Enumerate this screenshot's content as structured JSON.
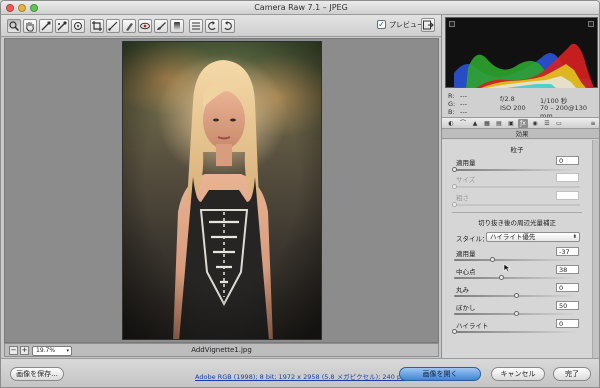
{
  "window": {
    "title": "Camera Raw 7.1  –  JPEG"
  },
  "toolbar": {
    "tools": [
      {
        "name": "zoom-tool-icon",
        "glyph": "🔍"
      },
      {
        "name": "hand-tool-icon",
        "glyph": "✋"
      },
      {
        "name": "white-balance-tool-icon",
        "glyph": "⌖"
      },
      {
        "name": "color-sampler-tool-icon",
        "glyph": "⊕"
      },
      {
        "name": "targeted-adjustment-tool-icon",
        "glyph": "◎"
      },
      {
        "name": "crop-tool-icon",
        "glyph": "⌗"
      },
      {
        "name": "straighten-tool-icon",
        "glyph": "⟋"
      },
      {
        "name": "spot-removal-tool-icon",
        "glyph": "✎"
      },
      {
        "name": "red-eye-tool-icon",
        "glyph": "◉"
      },
      {
        "name": "adjustment-brush-icon",
        "glyph": "✐"
      },
      {
        "name": "graduated-filter-icon",
        "glyph": "▮"
      },
      {
        "name": "preferences-icon",
        "glyph": "☰"
      },
      {
        "name": "rotate-left-icon",
        "glyph": "↺"
      },
      {
        "name": "rotate-right-icon",
        "glyph": "↻"
      }
    ],
    "preview_label": "プレビュー",
    "preview_checked": true
  },
  "photo_view": {
    "zoom": "19.7%",
    "filename": "AddVignette1.jpg"
  },
  "info": {
    "r_label": "R:",
    "g_label": "G:",
    "b_label": "B:",
    "r_value": "---",
    "g_value": "---",
    "b_value": "---",
    "aperture": "f/2.8",
    "shutter": "1/100 秒",
    "iso": "ISO 200",
    "lens": "70 – 200@130 mm"
  },
  "panel": {
    "header": "効果",
    "grain": {
      "title": "粒子",
      "amount_label": "適用量",
      "amount_value": "0",
      "amount_fraction": 0,
      "size_label": "サイズ",
      "size_value": "",
      "roughness_label": "粗さ",
      "roughness_value": ""
    },
    "vignette": {
      "title": "切り抜き後の周辺光量補正",
      "style_label": "スタイル：",
      "style_value": "ハイライト優先",
      "amount_label": "適用量",
      "amount_value": "-37",
      "amount_fraction": 0.31,
      "midpoint_label": "中心点",
      "midpoint_value": "38",
      "midpoint_fraction": 0.38,
      "roundness_label": "丸み",
      "roundness_value": "0",
      "roundness_fraction": 0.5,
      "feather_label": "ぼかし",
      "feather_value": "50",
      "feather_fraction": 0.5,
      "highlights_label": "ハイライト",
      "highlights_value": "0",
      "highlights_fraction": 0
    }
  },
  "footer": {
    "save_label": "画像を保存...",
    "workflow_link": "Adobe RGB (1998); 8 bit; 1972 x 2958 (5.8 メガピクセル); 240 ppi",
    "open_label": "画像を開く",
    "cancel_label": "キャンセル",
    "done_label": "完了"
  },
  "colors": {
    "accent": "#3f86d6",
    "link": "#1a3ca8"
  }
}
